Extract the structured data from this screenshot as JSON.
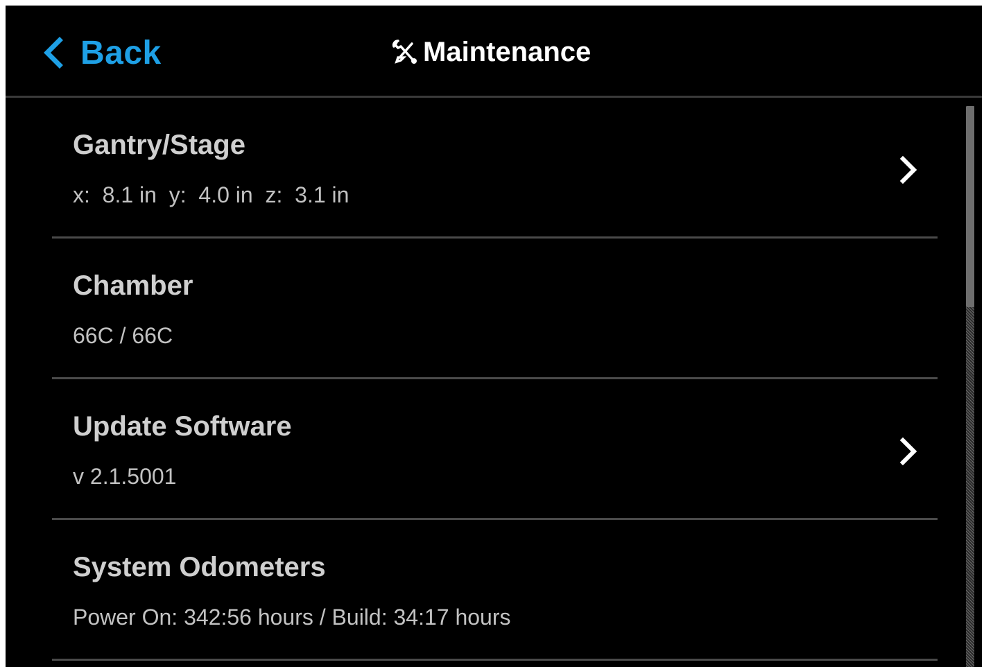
{
  "header": {
    "back_label": "Back",
    "title": "Maintenance",
    "title_icon": "wrench-icon",
    "back_icon": "chevron-left-icon",
    "accent_color": "#1ea0e6"
  },
  "items": [
    {
      "title": "Gantry/Stage",
      "subtitle": "x:  8.1 in  y:  4.0 in  z:  3.1 in",
      "has_chevron": true
    },
    {
      "title": "Chamber",
      "subtitle": "66C / 66C",
      "has_chevron": false
    },
    {
      "title": "Update Software",
      "subtitle": "v 2.1.5001",
      "has_chevron": true
    },
    {
      "title": "System Odometers",
      "subtitle": "Power On: 342:56 hours / Build: 34:17 hours",
      "has_chevron": false
    }
  ]
}
